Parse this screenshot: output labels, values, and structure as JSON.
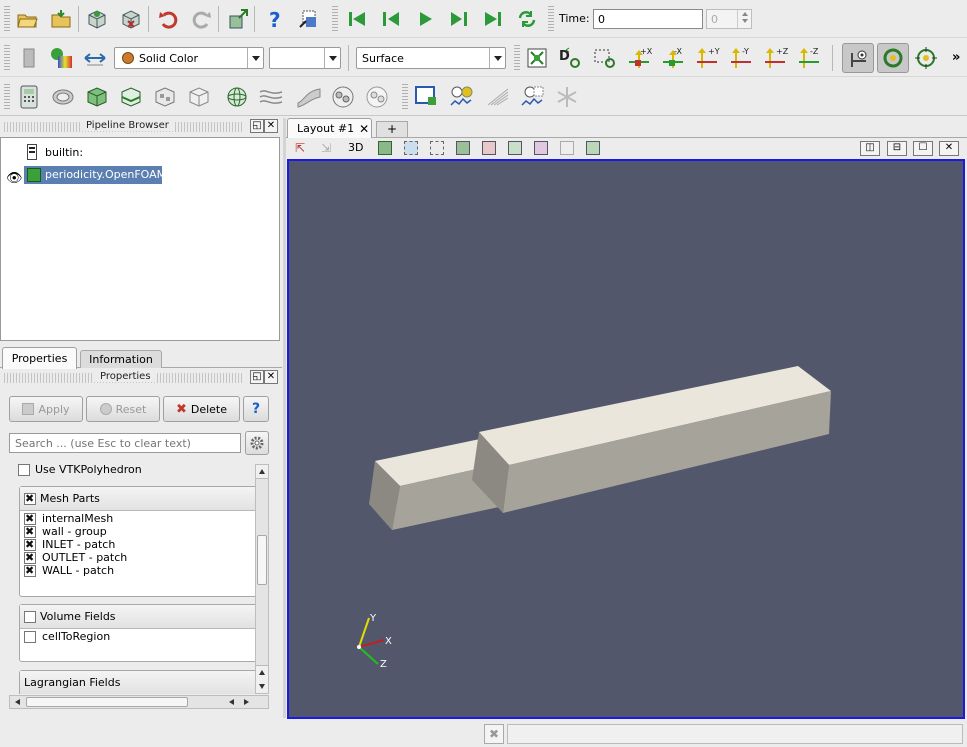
{
  "toolbar": {
    "time_label": "Time:",
    "time_value": "0",
    "time_index": "0",
    "coloring_value": "Solid Color",
    "component_value": "",
    "representation_value": "Surface",
    "camera_labels": [
      "+X",
      "-X",
      "+Y",
      "-Y",
      "+Z",
      "-Z"
    ]
  },
  "pipeline": {
    "title": "Pipeline Browser",
    "items": [
      {
        "label": "builtin:"
      },
      {
        "label": "periodicity.OpenFOAM"
      }
    ]
  },
  "tabs": {
    "properties": "Properties",
    "information": "Information"
  },
  "properties": {
    "title": "Properties",
    "apply_label": "Apply",
    "reset_label": "Reset",
    "delete_label": "Delete",
    "help_label": "?",
    "search_placeholder": "Search ... (use Esc to clear text)",
    "use_vtk_polyhedron": "Use VTKPolyhedron",
    "mesh_parts": {
      "title": "Mesh Parts",
      "items": [
        "internalMesh",
        "wall - group",
        "INLET - patch",
        "OUTLET - patch",
        "WALL - patch"
      ]
    },
    "volume_fields": {
      "title": "Volume Fields",
      "items": [
        "cellToRegion"
      ]
    },
    "lagrangian_fields": {
      "title": "Lagrangian Fields"
    }
  },
  "layout": {
    "tab_label": "Layout #1",
    "add_tab": "+",
    "view_3d_label": "3D"
  },
  "view": {
    "background": "#52576c",
    "axes": {
      "y": "Y",
      "x": "X",
      "z": "Z"
    }
  },
  "colors": {
    "selection_border": "#1a1ae6",
    "selected_item": "#5a7fb0",
    "solid_fill": "#ebe6dc"
  }
}
